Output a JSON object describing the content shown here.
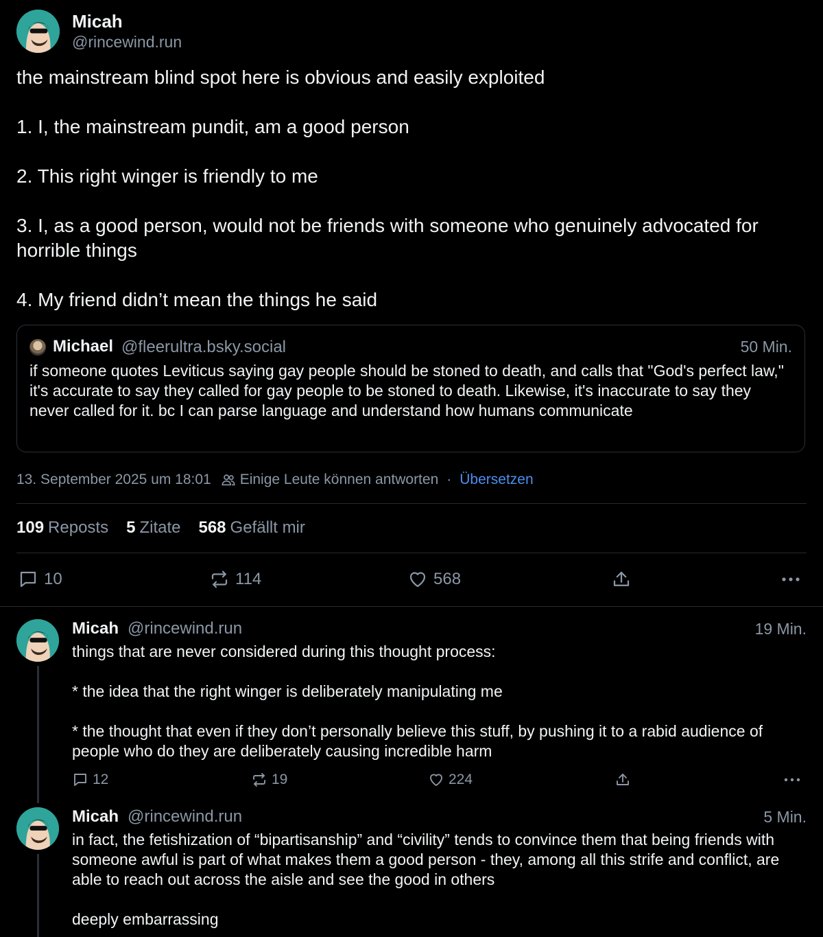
{
  "main_post": {
    "author_name": "Micah",
    "author_handle": "@rincewind.run",
    "paragraphs": [
      "the mainstream blind spot here is obvious and easily exploited",
      "1. I, the mainstream pundit, am a good person",
      "2. This right winger is friendly to me",
      "3. I, as a good person, would not be friends with someone who genuinely advocated for horrible things",
      "4. My friend didn’t mean the things he said"
    ],
    "quote": {
      "author_name": "Michael",
      "author_handle": "@fleerultra.bsky.social",
      "time": "50 Min.",
      "text": "if someone quotes Leviticus saying gay people should be stoned to death, and calls that \"God's perfect law,\" it's accurate to say they called for gay people to be stoned to death. Likewise, it's inaccurate to say they never called for it. bc I can parse language and understand how humans communicate"
    },
    "timestamp": "13. September 2025 um 18:01",
    "reply_setting": "Einige Leute können antworten",
    "separator": "·",
    "translate_label": "Übersetzen",
    "stats": {
      "reposts_count": "109",
      "reposts_label": "Reposts",
      "quotes_count": "5",
      "quotes_label": "Zitate",
      "likes_count": "568",
      "likes_label": "Gefällt mir"
    },
    "actions": {
      "replies": "10",
      "reposts": "114",
      "likes": "568"
    }
  },
  "replies": [
    {
      "author_name": "Micah",
      "author_handle": "@rincewind.run",
      "time": "19 Min.",
      "paragraphs": [
        "things that are never considered during this thought process:",
        "* the idea that the right winger is deliberately manipulating me",
        "* the thought that even if they don’t personally believe this stuff, by pushing it to a rabid audience of people who do they are deliberately causing incredible harm"
      ],
      "actions": {
        "replies": "12",
        "reposts": "19",
        "likes": "224"
      }
    },
    {
      "author_name": "Micah",
      "author_handle": "@rincewind.run",
      "time": "5 Min.",
      "paragraphs": [
        "in fact, the fetishization of “bipartisanship” and “civility” tends to convince them that being friends with someone awful is part of what makes them a good person - they, among all this strife and conflict, are able to reach out across the aisle and see the good in others",
        "deeply embarrassing"
      ]
    }
  ],
  "icons": {
    "reply": "speech-bubble-icon",
    "repost": "repost-arrows-icon",
    "like": "heart-icon",
    "share": "share-upload-icon",
    "more": "ellipsis-icon",
    "people": "people-icon"
  },
  "colors": {
    "background": "#000000",
    "text": "#f1f3f5",
    "muted": "#8b97a6",
    "link": "#4d8ef0",
    "border": "#2b3038",
    "avatar_bg": "#2ea49a"
  }
}
